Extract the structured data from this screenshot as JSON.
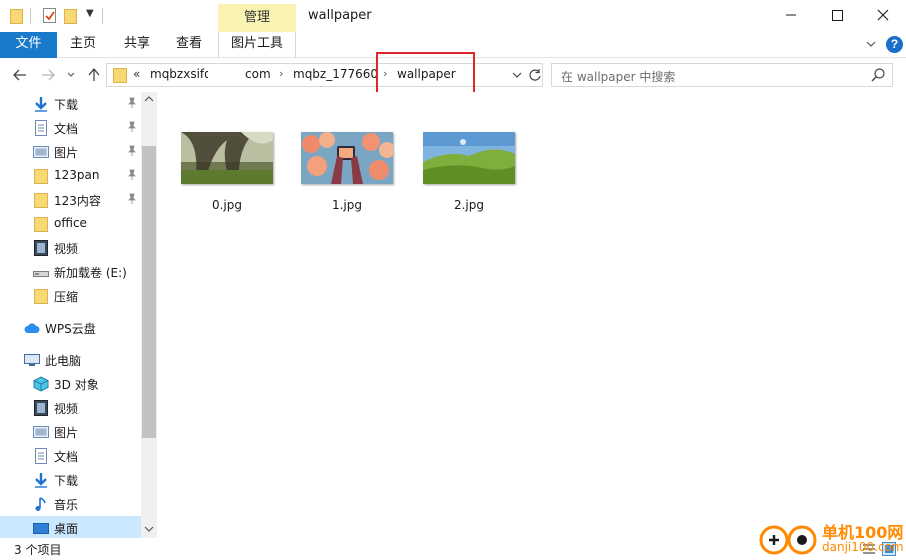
{
  "window": {
    "title": "wallpaper",
    "contextual_group": "管理"
  },
  "ribbon": {
    "tabs": [
      {
        "label": "文件",
        "active": true
      },
      {
        "label": "主页"
      },
      {
        "label": "共享"
      },
      {
        "label": "查看"
      },
      {
        "label": "图片工具"
      }
    ],
    "help": "?"
  },
  "address": {
    "overflow": "«",
    "crumbs": [
      "mqbzxsifd",
      "com",
      "mqbz_177660",
      "wallpaper"
    ],
    "separator": "›"
  },
  "search": {
    "placeholder": "在 wallpaper 中搜索"
  },
  "sidebar": {
    "items": [
      {
        "label": "下载",
        "icon": "download-icon",
        "pinned": true
      },
      {
        "label": "文档",
        "icon": "document-icon",
        "pinned": true
      },
      {
        "label": "图片",
        "icon": "pictures-icon",
        "pinned": true
      },
      {
        "label": "123pan",
        "icon": "folder-icon",
        "pinned": true
      },
      {
        "label": "123内容",
        "icon": "folder-icon",
        "pinned": true
      },
      {
        "label": "office",
        "icon": "folder-icon"
      },
      {
        "label": "视频",
        "icon": "video-icon"
      },
      {
        "label": "新加载卷 (E:)",
        "icon": "drive-icon"
      },
      {
        "label": "压缩",
        "icon": "folder-icon"
      },
      {
        "label": "WPS云盘",
        "icon": "cloud-icon"
      },
      {
        "label": "此电脑",
        "icon": "computer-icon"
      },
      {
        "label": "3D 对象",
        "icon": "3d-objects-icon"
      },
      {
        "label": "视频",
        "icon": "video-icon"
      },
      {
        "label": "图片",
        "icon": "pictures-icon"
      },
      {
        "label": "文档",
        "icon": "document-icon"
      },
      {
        "label": "下载",
        "icon": "download-icon"
      },
      {
        "label": "音乐",
        "icon": "music-icon"
      },
      {
        "label": "桌面",
        "icon": "desktop-icon",
        "selected": true
      }
    ]
  },
  "files": [
    {
      "name": "0.jpg",
      "thumb": "forest-trees"
    },
    {
      "name": "1.jpg",
      "thumb": "hands-and-flowers"
    },
    {
      "name": "2.jpg",
      "thumb": "green-hills"
    }
  ],
  "status": {
    "count": "3 个项目"
  },
  "watermark": {
    "title": "单机100网",
    "subtitle": "danji100.com"
  },
  "colors": {
    "accent": "#1979ca",
    "contextual_tab": "#fbf3b3",
    "highlight": "#e0262a",
    "selection": "#cce8ff",
    "watermark": "#ff8a00"
  }
}
